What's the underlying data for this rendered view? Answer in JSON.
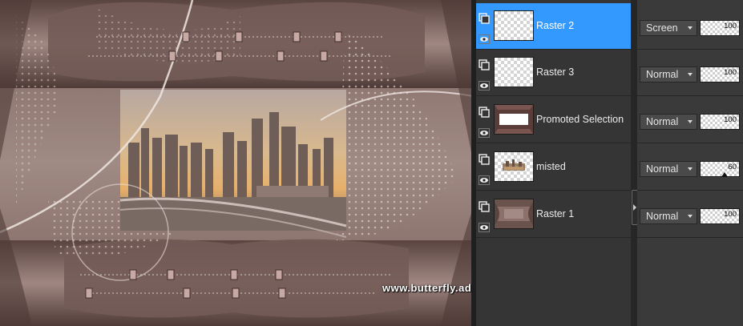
{
  "artwork": {
    "watermark": "www.butterfly.adv.br – Maria José",
    "palette": {
      "dark": "#4b3834",
      "mid": "#8c736d",
      "light": "#c7b4ae",
      "sky": "#e7b06a"
    }
  },
  "layers_panel": {
    "layers": [
      {
        "name": "Raster 2",
        "blend_mode": "Screen",
        "opacity": 100,
        "selected": true,
        "thumbnail": "transparent"
      },
      {
        "name": "Raster 3",
        "blend_mode": "Normal",
        "opacity": 100,
        "selected": false,
        "thumbnail": "transparent"
      },
      {
        "name": "Promoted Selection",
        "blend_mode": "Normal",
        "opacity": 100,
        "selected": false,
        "thumbnail": "frame"
      },
      {
        "name": "misted",
        "blend_mode": "Normal",
        "opacity": 60,
        "selected": false,
        "thumbnail": "misted"
      },
      {
        "name": "Raster 1",
        "blend_mode": "Normal",
        "opacity": 100,
        "selected": false,
        "thumbnail": "background"
      }
    ],
    "colors": {
      "selection": "#3399ff",
      "panel": "#353535"
    },
    "icons": {
      "group": "layer-group-icon",
      "visibility": "eye-icon"
    }
  }
}
